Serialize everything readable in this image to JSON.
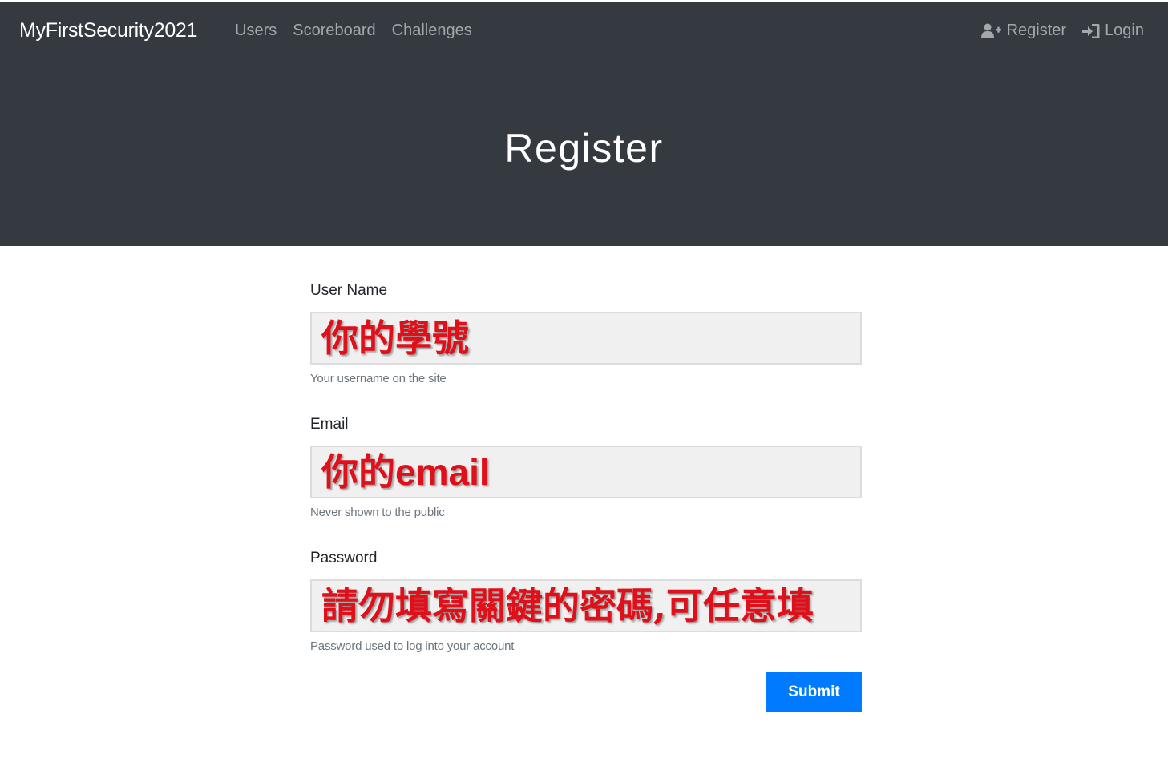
{
  "nav": {
    "brand": "MyFirstSecurity2021",
    "links": [
      "Users",
      "Scoreboard",
      "Challenges"
    ],
    "register": "Register",
    "login": "Login",
    "register_icon": "user-plus-icon",
    "login_icon": "sign-in-icon"
  },
  "page": {
    "title": "Register"
  },
  "form": {
    "fields": [
      {
        "label": "User Name",
        "value": "你的學號",
        "help": "Your username on the site"
      },
      {
        "label": "Email",
        "value_prefix": "你的",
        "value_suffix": "email",
        "help": "Never shown to the public"
      },
      {
        "label": "Password",
        "value": "請勿填寫關鍵的密碼,可任意填",
        "help": "Password used to log into your account"
      }
    ],
    "submit": "Submit"
  },
  "colors": {
    "navbar": "#343a40",
    "nav_text": "#a4a8ac",
    "annotation_red": "#e0101a",
    "input_bg": "#f0f0f0",
    "button": "#007bff"
  }
}
